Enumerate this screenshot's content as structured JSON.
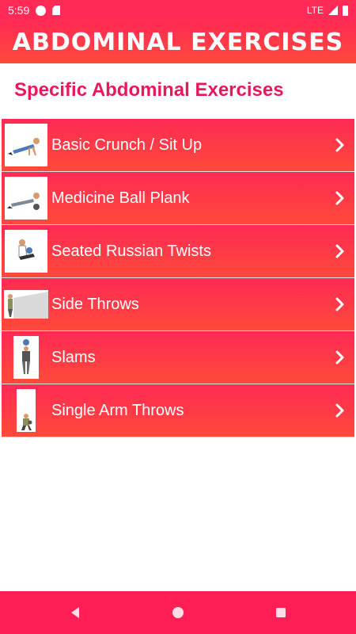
{
  "status_bar": {
    "time": "5:59",
    "network": "LTE",
    "icons": [
      "notification-app-icon",
      "sd-card-icon",
      "wifi-signal-icon",
      "signal-icon",
      "battery-icon"
    ]
  },
  "app_bar": {
    "title": "ABDOMINAL EXERCISES"
  },
  "section": {
    "title": "Specific Abdominal Exercises"
  },
  "exercises": [
    {
      "label": "Basic Crunch / Sit Up",
      "icon": "crunch-illustration"
    },
    {
      "label": "Medicine Ball Plank",
      "icon": "plank-illustration"
    },
    {
      "label": "Seated Russian Twists",
      "icon": "russian-twist-illustration"
    },
    {
      "label": "Side Throws",
      "icon": "side-throw-illustration"
    },
    {
      "label": "Slams",
      "icon": "slam-illustration"
    },
    {
      "label": "Single Arm Throws",
      "icon": "single-arm-throw-illustration"
    }
  ],
  "nav_bar": {
    "buttons": [
      "back-icon",
      "home-icon",
      "recents-icon"
    ]
  },
  "colors": {
    "accent": "#ff2a55",
    "gradient_bottom": "#ff4a3a",
    "section_title": "#e8195a",
    "nav_bar": "#ff1f56"
  }
}
